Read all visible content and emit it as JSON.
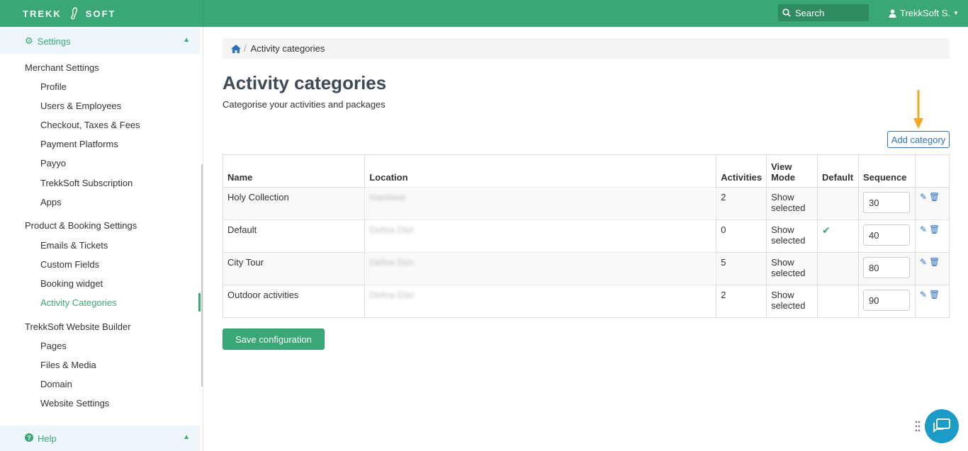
{
  "brand": {
    "left": "TREKK",
    "right": "SOFT"
  },
  "topbar": {
    "search_label": "Search",
    "user_name": "TrekkSoft S."
  },
  "sidebar": {
    "settings_label": "Settings",
    "help_label": "Help",
    "groups": [
      {
        "label": "Merchant Settings",
        "items": [
          "Profile",
          "Users & Employees",
          "Checkout, Taxes & Fees",
          "Payment Platforms",
          "Payyo",
          "TrekkSoft Subscription",
          "Apps"
        ]
      },
      {
        "label": "Product & Booking Settings",
        "items": [
          "Emails & Tickets",
          "Custom Fields",
          "Booking widget",
          "Activity Categories"
        ]
      },
      {
        "label": "TrekkSoft Website Builder",
        "items": [
          "Pages",
          "Files & Media",
          "Domain",
          "Website Settings"
        ]
      }
    ],
    "active_item": "Activity Categories"
  },
  "breadcrumb": {
    "current": "Activity categories"
  },
  "page": {
    "title": "Activity categories",
    "subtitle": "Categorise your activities and packages",
    "add_button": "Add category",
    "save_button": "Save configuration"
  },
  "table": {
    "headers": {
      "name": "Name",
      "location": "Location",
      "activities": "Activities",
      "view_mode_1": "View",
      "view_mode_2": "Mode",
      "default": "Default",
      "sequence": "Sequence"
    },
    "rows": [
      {
        "name": "Holy Collection",
        "location": "Haridwar",
        "activities": "2",
        "view_1": "Show",
        "view_2": "selected",
        "default": "",
        "sequence": "30"
      },
      {
        "name": "Default",
        "location": "Dehra Dūn",
        "activities": "0",
        "view_1": "Show",
        "view_2": "selected",
        "default": "✔",
        "sequence": "40"
      },
      {
        "name": "City Tour",
        "location": "Dehra Dūn",
        "activities": "5",
        "view_1": "Show",
        "view_2": "selected",
        "default": "",
        "sequence": "80"
      },
      {
        "name": "Outdoor activities",
        "location": "Dehra Dūn",
        "activities": "2",
        "view_1": "Show",
        "view_2": "selected",
        "default": "",
        "sequence": "90"
      }
    ]
  },
  "colors": {
    "brand_green": "#3aa876",
    "link_blue": "#2f6fbf",
    "arrow_orange": "#f5a623",
    "chat_blue": "#1b9bc7"
  },
  "icons": {
    "home": "home-icon",
    "edit": "pencil-icon",
    "delete": "trash-icon",
    "chat": "chat-icon",
    "settings": "gear-icon",
    "help": "question-icon"
  }
}
